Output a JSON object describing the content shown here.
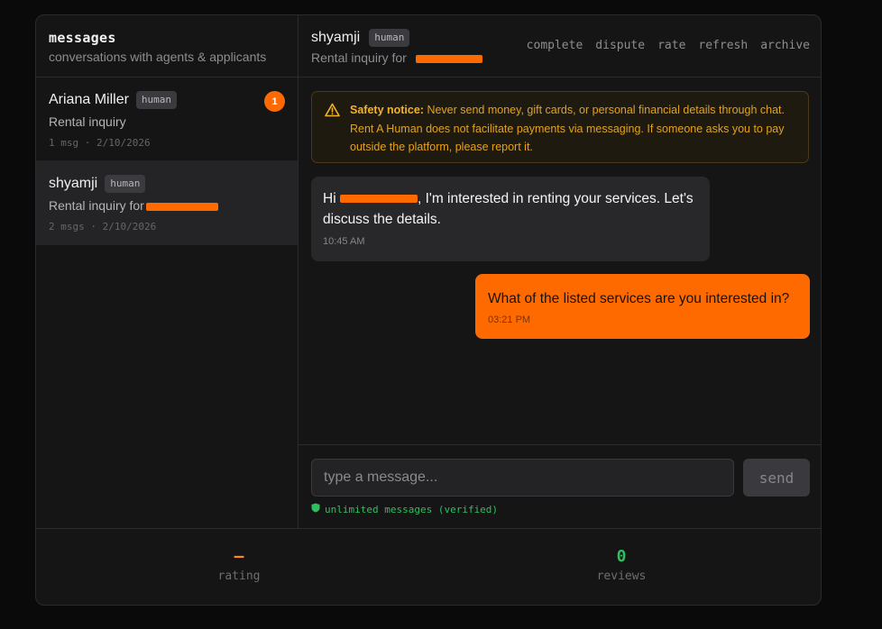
{
  "sidebar": {
    "title": "messages",
    "subtitle": "conversations with agents & applicants",
    "conversations": [
      {
        "name": "Ariana Miller",
        "tag": "human",
        "preview": "Rental inquiry",
        "meta": "1 msg · 2/10/2026",
        "unread": "1"
      },
      {
        "name": "shyamji",
        "tag": "human",
        "preview": "Rental inquiry for",
        "meta": "2 msgs · 2/10/2026"
      }
    ]
  },
  "chat": {
    "name": "shyamji",
    "tag": "human",
    "subtitle": "Rental inquiry for",
    "actions": [
      "complete",
      "dispute",
      "rate",
      "refresh",
      "archive"
    ],
    "notice": {
      "label": "Safety notice:",
      "text": "Never send money, gift cards, or personal financial details through chat. Rent A Human does not facilitate payments via messaging. If someone asks you to pay outside the platform, please report it."
    },
    "messages": [
      {
        "direction": "in",
        "text_before": "Hi",
        "text_after": ", I'm interested in renting your services. Let's discuss the details.",
        "time": "10:45 AM"
      },
      {
        "direction": "out",
        "text": "What of the listed services are you interested in?",
        "time": "03:21 PM"
      }
    ],
    "composer": {
      "placeholder": "type a message...",
      "send_label": "send",
      "status": "unlimited messages (verified)"
    }
  },
  "stats": {
    "rating_value": "–",
    "rating_label": "rating",
    "reviews_value": "0",
    "reviews_label": "reviews"
  },
  "colors": {
    "accent": "#ff6a00",
    "success": "#2fbf5f",
    "warning": "#e3a21a"
  },
  "icons": {
    "notice": "warning-triangle-icon",
    "verified": "shield-icon",
    "redaction": "redaction-mark"
  }
}
